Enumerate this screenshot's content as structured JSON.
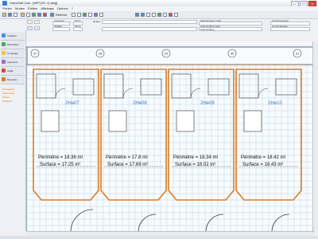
{
  "window": {
    "title": "CalcuSoft Cad - [MPT(05 .1).dwg]"
  },
  "menu": [
    "Fichier",
    "Modes",
    "Édition",
    "Affichage",
    "Options",
    "?"
  ],
  "toolbar": {
    "refresh_label": "Refresh"
  },
  "fields": {
    "longueur_label": "Longueur",
    "longueur_value": "",
    "surface_label": "Surface",
    "surface_value": "",
    "opt1_label": "Opt 1",
    "opt2_label": "Opt 2",
    "default_label": "Défaut",
    "total_longueur_label": "Total longueur Card",
    "total_surface_label": "Total Surface Card",
    "total_surface_value": "Total Surface",
    "cumul_longueur_label": "Cumul longueur",
    "cumul_surface_label": "Cumul Surface"
  },
  "sidebar": {
    "items": [
      {
        "label": "Surfaces",
        "icon": "surface-icon"
      },
      {
        "label": "Périmètres",
        "icon": "perimeter-icon"
      },
      {
        "label": "Comptage",
        "icon": "count-icon"
      },
      {
        "label": "Segments",
        "icon": "segment-icon"
      },
      {
        "label": "Angle",
        "icon": "angle-icon"
      },
      {
        "label": "Remarks",
        "icon": "remark-icon"
      }
    ],
    "links": [
      "Remarques",
      "Paramètres",
      "Calcul",
      "Surfaces"
    ]
  },
  "rooms": [
    {
      "id": "2He07",
      "perimeter": "Périmètre = 18.36 ml",
      "surface": "Surface = 17.25 m²"
    },
    {
      "id": "2He08",
      "perimeter": "Périmètre = 17.8 ml",
      "surface": "Surface = 17.69 m²"
    },
    {
      "id": "2He09",
      "perimeter": "Périmètre = 18.34 ml",
      "surface": "Surface = 18.02 m²"
    },
    {
      "id": "2He10",
      "perimeter": "Périmètre = 18.42 ml",
      "surface": "Surface = 18.43 m²"
    }
  ],
  "grid_markers": [
    "27",
    "28",
    "29",
    "30",
    "31"
  ],
  "colors": {
    "outline": "#e07a1f",
    "room_label": "#3a6fd0",
    "plan_line": "#333333",
    "grid": "#b7d5ec"
  }
}
